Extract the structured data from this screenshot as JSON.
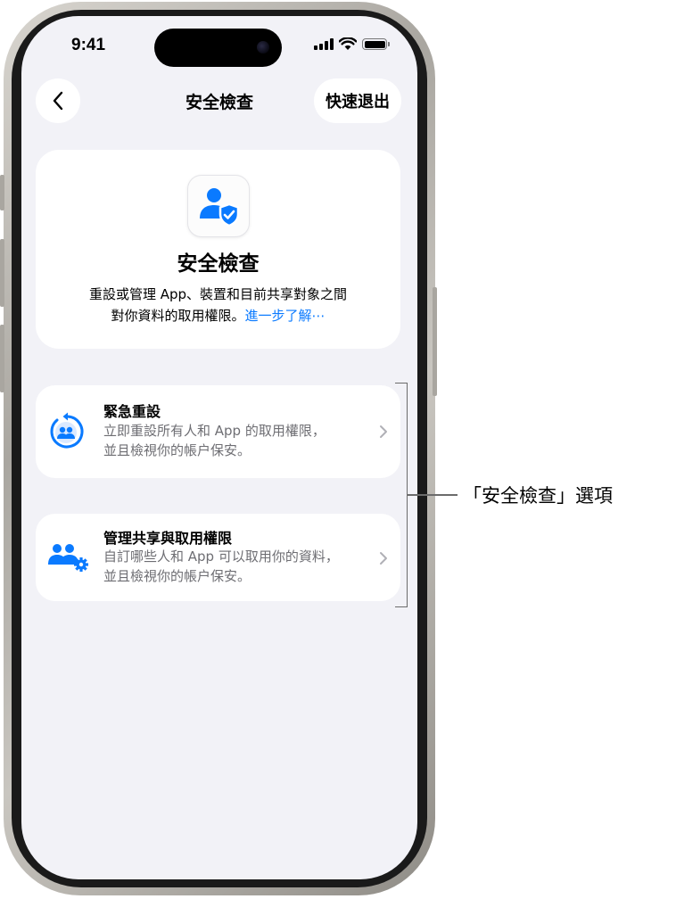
{
  "status_bar": {
    "time": "9:41"
  },
  "nav": {
    "title": "安全檢查",
    "quick_exit": "快速退出"
  },
  "header_card": {
    "title": "安全檢查",
    "description_line1": "重設或管理 App、裝置和目前共享對象之間",
    "description_line2": "對你資料的取用權限。",
    "learn_more": "進一步了解⋯"
  },
  "options": [
    {
      "title": "緊急重設",
      "subtitle_line1": "立即重設所有人和 App 的取用權限，",
      "subtitle_line2": "並且檢視你的帳户保安。",
      "icon": "emergency-reset-icon"
    },
    {
      "title": "管理共享與取用權限",
      "subtitle_line1": "自訂哪些人和 App 可以取用你的資料，",
      "subtitle_line2": "並且檢視你的帳户保安。",
      "icon": "manage-sharing-icon"
    }
  ],
  "callout": {
    "label": "「安全檢查」選項"
  },
  "colors": {
    "accent": "#0a7aff",
    "screen_bg": "#f2f2f7",
    "card_bg": "#ffffff",
    "secondary_text": "#6e6e73"
  }
}
